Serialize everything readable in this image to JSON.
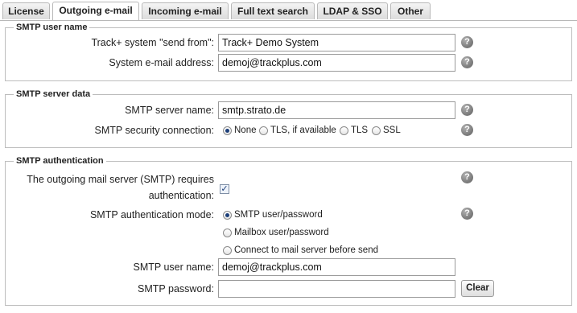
{
  "tabs": [
    {
      "label": "License"
    },
    {
      "label": "Outgoing e-mail"
    },
    {
      "label": "Incoming e-mail"
    },
    {
      "label": "Full text search"
    },
    {
      "label": "LDAP & SSO"
    },
    {
      "label": "Other"
    }
  ],
  "active_tab": "Outgoing e-mail",
  "smtp_user_name_group": {
    "legend": "SMTP user name",
    "send_from_label": "Track+ system \"send from\":",
    "send_from_value": "Track+ Demo System",
    "email_label": "System e-mail address:",
    "email_value": "demoj@trackplus.com"
  },
  "smtp_server_group": {
    "legend": "SMTP server data",
    "server_label": "SMTP server name:",
    "server_value": "smtp.strato.de",
    "security_label": "SMTP security connection:",
    "security_options": [
      "None",
      "TLS, if available",
      "TLS",
      "SSL"
    ],
    "security_selected": "None"
  },
  "smtp_auth_group": {
    "legend": "SMTP authentication",
    "requires_auth_label_line1": "The outgoing mail server (SMTP) requires",
    "requires_auth_label_line2": "authentication:",
    "requires_auth_checked": true,
    "mode_label": "SMTP authentication mode:",
    "mode_options": [
      "SMTP user/password",
      "Mailbox user/password",
      "Connect to mail server before send"
    ],
    "mode_selected": "SMTP user/password",
    "user_label": "SMTP user name:",
    "user_value": "demoj@trackplus.com",
    "password_label": "SMTP password:",
    "password_value": "",
    "clear_button": "Clear"
  },
  "help_icon_glyph": "?",
  "checkbox_glyph": "✓"
}
